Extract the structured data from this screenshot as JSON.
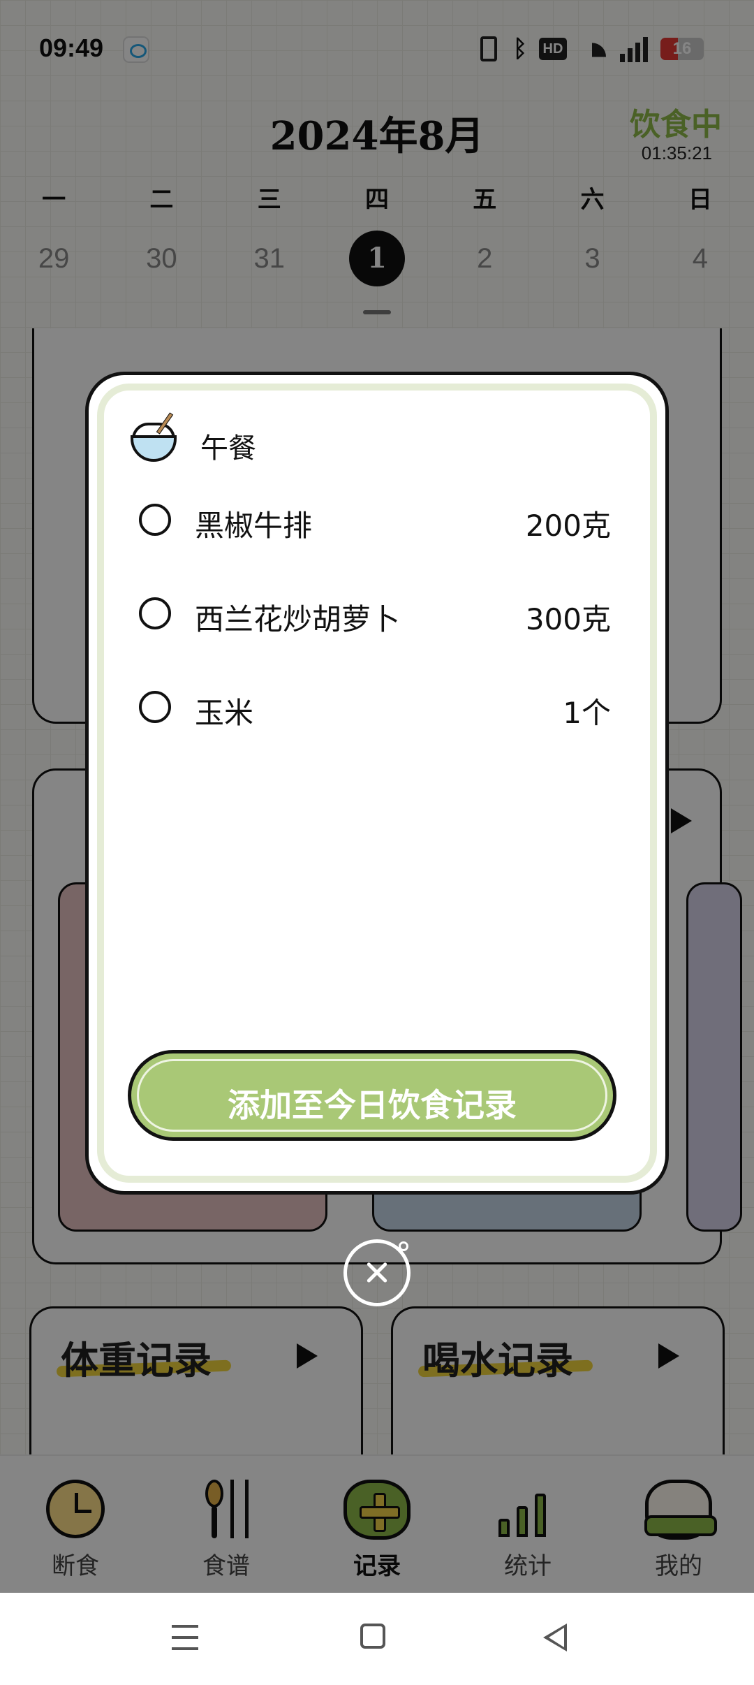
{
  "status_bar": {
    "time": "09:49",
    "battery_level": "16",
    "network_label": "HD",
    "icons": [
      "chat-app-icon",
      "vibrate-icon",
      "bluetooth-icon",
      "hd-icon",
      "wifi-icon",
      "signal-4g-icon",
      "battery-icon"
    ]
  },
  "calendar": {
    "month_title": "2024年8月",
    "fasting_status": "饮食中",
    "fasting_timer": "01:35:21",
    "weekdays": [
      "一",
      "二",
      "三",
      "四",
      "五",
      "六",
      "日"
    ],
    "dates": [
      "29",
      "30",
      "31",
      "1",
      "2",
      "3",
      "4"
    ],
    "selected_date": "1"
  },
  "cards": {
    "weight_title": "体重记录",
    "water_title": "喝水记录"
  },
  "tab_bar": {
    "tabs": [
      {
        "label": "断食",
        "icon": "clock-icon"
      },
      {
        "label": "食谱",
        "icon": "spoon-fork-icon"
      },
      {
        "label": "记录",
        "icon": "add-record-icon"
      },
      {
        "label": "统计",
        "icon": "chart-icon"
      },
      {
        "label": "我的",
        "icon": "bear-icon"
      }
    ],
    "active": "记录"
  },
  "modal": {
    "meal_icon": "rice-bowl-icon",
    "meal_title": "午餐",
    "foods": [
      {
        "name": "黑椒牛排",
        "amount": "200克"
      },
      {
        "name": "西兰花炒胡萝卜",
        "amount": "300克"
      },
      {
        "name": "玉米",
        "amount": "1个"
      }
    ],
    "add_button_label": "添加至今日饮食记录"
  },
  "colors": {
    "accent_green": "#a9c876",
    "fasting_green": "#8fbb4a",
    "highlight_yellow": "#f2d53c",
    "overlay": "rgba(0,0,0,0.48)"
  }
}
